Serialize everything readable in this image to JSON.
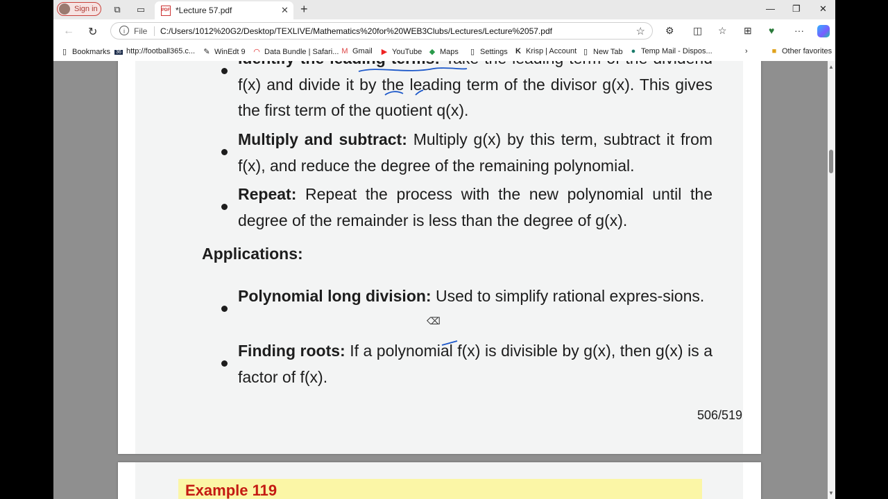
{
  "tabbar": {
    "signin_label": "Sign in",
    "tab_title": "*Lecture 57.pdf",
    "pdf_badge": "PDF",
    "close_glyph": "✕",
    "newtab_glyph": "+",
    "minimize_glyph": "—",
    "restore_glyph": "❐",
    "window_close_glyph": "✕"
  },
  "address": {
    "file_label": "File",
    "url": "C:/Users/1012%20G2/Desktop/TEXLIVE/Mathematics%20for%20WEB3Clubs/Lectures/Lecture%2057.pdf",
    "back_glyph": "←",
    "reload_glyph": "↻",
    "star_glyph": "☆"
  },
  "bookmarks": [
    {
      "label": "Bookmarks",
      "icon": "bookmark-icon"
    },
    {
      "label": "http://football365.c...",
      "icon": "site-icon"
    },
    {
      "label": "WinEdt 9",
      "icon": "winedt-icon"
    },
    {
      "label": "Data Bundle | Safari...",
      "icon": "safaricom-icon"
    },
    {
      "label": "Gmail",
      "icon": "gmail-icon"
    },
    {
      "label": "YouTube",
      "icon": "youtube-icon"
    },
    {
      "label": "Maps",
      "icon": "maps-icon"
    },
    {
      "label": "Settings",
      "icon": "page-icon"
    },
    {
      "label": "Krisp | Account",
      "icon": "krisp-icon"
    },
    {
      "label": "New Tab",
      "icon": "page-icon"
    },
    {
      "label": "Temp Mail - Dispos...",
      "icon": "tempmail-icon"
    },
    {
      "label": "Other favorites",
      "icon": "folder-icon"
    }
  ],
  "pdf": {
    "items": [
      {
        "kw": "Identify the leading terms:",
        "text": "Take the leading term of the dividend f(x) and divide it by the leading term of the divisor g(x). This gives the first term of the quotient q(x)."
      },
      {
        "kw": "Multiply and subtract:",
        "text": "Multiply g(x) by this term, subtract it from f(x), and reduce the degree of the remaining polynomial."
      },
      {
        "kw": "Repeat:",
        "text": "Repeat the process with the new polynomial until the degree of the remainder is less than the degree of g(x)."
      }
    ],
    "applications_heading": "Applications:",
    "applications": [
      {
        "kw": "Polynomial long division:",
        "text": "Used to simplify rational expres-sions."
      },
      {
        "kw": "Finding roots:",
        "text": "If a polynomial f(x) is divisible by g(x), then g(x) is a factor of f(x)."
      }
    ],
    "page_number": "506/519",
    "next_example": "Example 119"
  },
  "colors": {
    "ink_annotation": "#1b57c9",
    "example_title": "#c41a12",
    "example_bg": "#fbf6a6"
  }
}
